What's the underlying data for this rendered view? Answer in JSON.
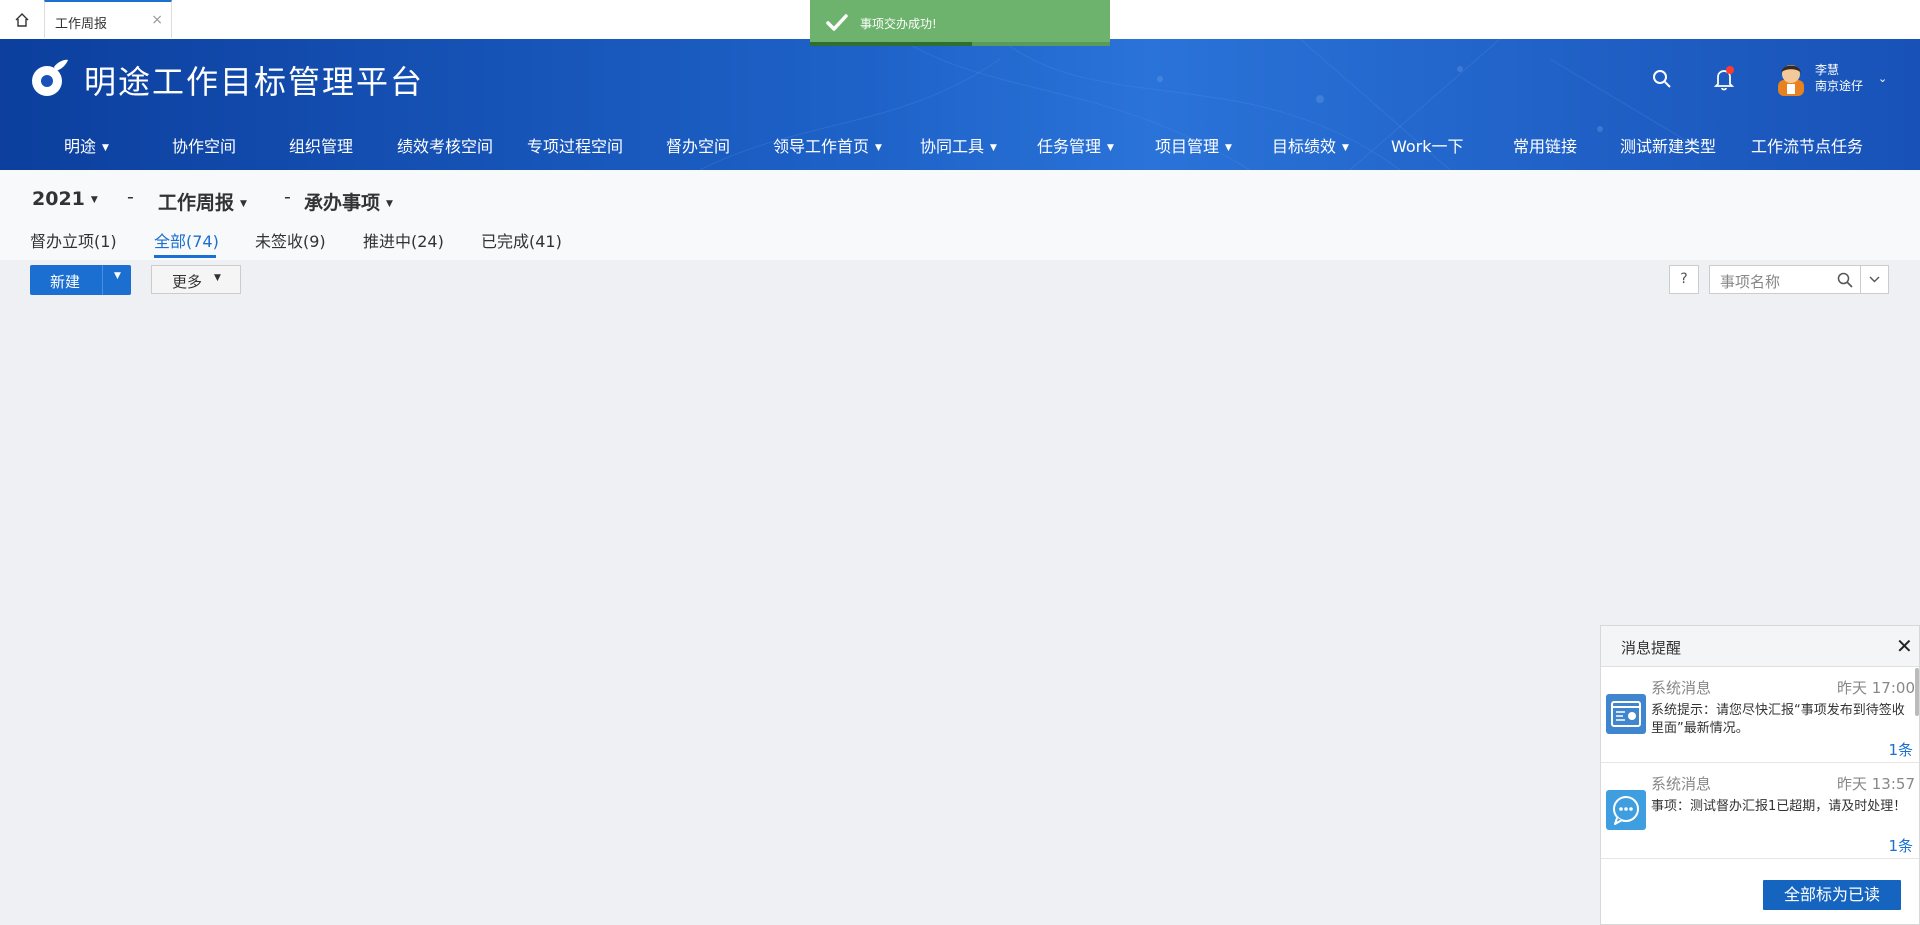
{
  "tabs": {
    "home_icon": "home-icon",
    "active_tab": "工作周报",
    "close": "×"
  },
  "header": {
    "title": "明途工作目标管理平台",
    "user_name": "李慧",
    "user_org": "南京途仔",
    "chevron": "⌄",
    "colors": {
      "brand": "#1852b8",
      "accent": "#1a6fd0"
    }
  },
  "nav": [
    {
      "label": "明途",
      "caret": "▼"
    },
    {
      "label": "协作空间",
      "caret": ""
    },
    {
      "label": "组织管理",
      "caret": ""
    },
    {
      "label": "绩效考核空间",
      "caret": ""
    },
    {
      "label": "专项过程空间",
      "caret": ""
    },
    {
      "label": "督办空间",
      "caret": ""
    },
    {
      "label": "领导工作首页",
      "caret": "▼"
    },
    {
      "label": "协同工具",
      "caret": "▼"
    },
    {
      "label": "任务管理",
      "caret": "▼"
    },
    {
      "label": "项目管理",
      "caret": "▼"
    },
    {
      "label": "目标绩效",
      "caret": "▼"
    },
    {
      "label": "Work一下",
      "caret": ""
    },
    {
      "label": "常用链接",
      "caret": ""
    },
    {
      "label": "测试新建类型",
      "caret": ""
    },
    {
      "label": "工作流节点任务",
      "caret": ""
    }
  ],
  "breadcrumb": {
    "year": "2021",
    "sep": "-",
    "category": "工作周报",
    "subcategory": "承办事项",
    "caret": "▼"
  },
  "filter_tabs": [
    {
      "label": "督办立项(1)"
    },
    {
      "label": "全部(74)"
    },
    {
      "label": "未签收(9)"
    },
    {
      "label": "推进中(24)"
    },
    {
      "label": "已完成(41)"
    }
  ],
  "toolbar": {
    "new_label": "新建",
    "more_label": "更多",
    "caret": "▼",
    "help": "?",
    "search_placeholder": "事项名称"
  },
  "toast": {
    "message": "事项交办成功!",
    "progress": 0.54
  },
  "notifications": {
    "title": "消息提醒",
    "close": "✕",
    "items": [
      {
        "type": "系统消息",
        "time": "昨天 17:00",
        "text": "系统提示：请您尽快汇报“事项发布到待签收里面”最新情况。",
        "count": "1条",
        "icon": "system-notice-icon"
      },
      {
        "type": "系统消息",
        "time": "昨天 13:57",
        "text": "事项：测试督办汇报1已超期，请及时处理！",
        "count": "1条",
        "icon": "chat-bubble-icon"
      }
    ],
    "mark_all_label": "全部标为已读"
  }
}
